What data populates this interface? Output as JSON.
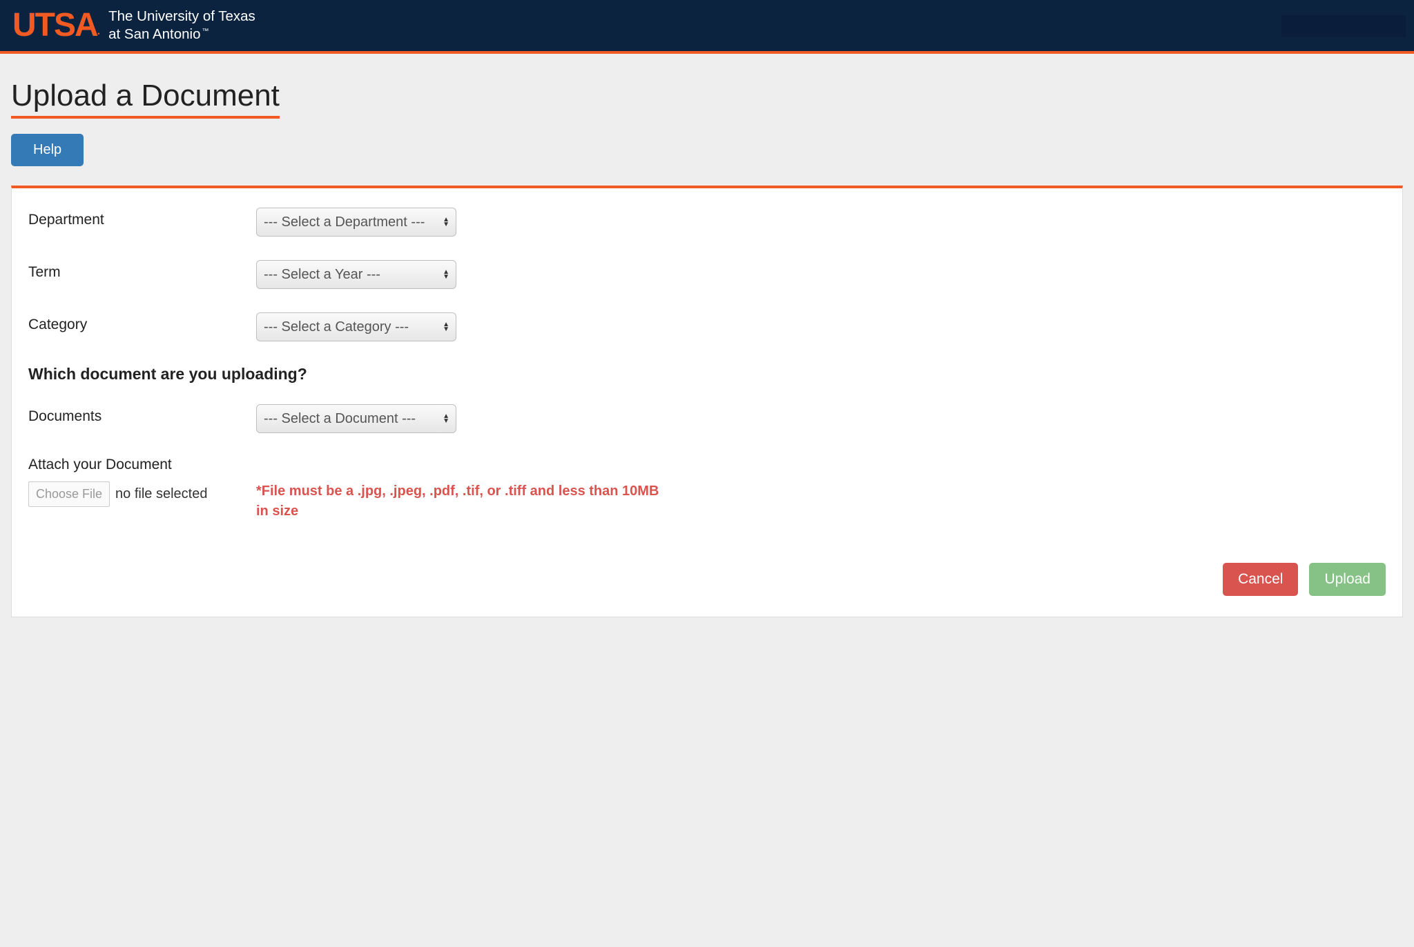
{
  "header": {
    "logo_text": "UTSA",
    "univ_line1": "The University of Texas",
    "univ_line2": "at San Antonio",
    "tm": "™"
  },
  "page": {
    "title": "Upload a Document",
    "help_label": "Help"
  },
  "form": {
    "department_label": "Department",
    "department_placeholder": "--- Select a Department ---",
    "term_label": "Term",
    "term_placeholder": "--- Select a Year ---",
    "category_label": "Category",
    "category_placeholder": "--- Select a Category ---",
    "section_heading": "Which document are you uploading?",
    "documents_label": "Documents",
    "documents_placeholder": "--- Select a Document ---",
    "attach_label": "Attach your Document",
    "choose_file_label": "Choose File",
    "file_status": "no file selected",
    "file_constraint": "*File must be a .jpg, .jpeg, .pdf, .tif, or .tiff and less than 10MB in size"
  },
  "buttons": {
    "cancel": "Cancel",
    "upload": "Upload"
  }
}
